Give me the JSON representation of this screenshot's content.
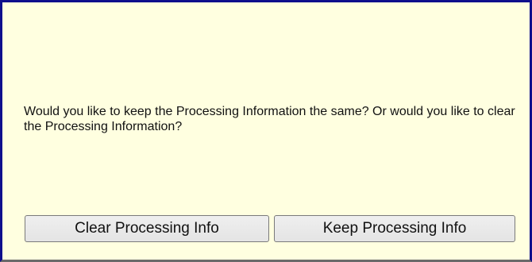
{
  "dialog": {
    "message": "Would you like to keep the Processing Information the same? Or would you like to clear the Processing Information?",
    "buttons": {
      "clear_label": "Clear Processing Info",
      "keep_label": "Keep Processing Info"
    }
  },
  "colors": {
    "background": "#ffffe0",
    "border": "#0f0f8c",
    "button": "#e9e9e9"
  }
}
